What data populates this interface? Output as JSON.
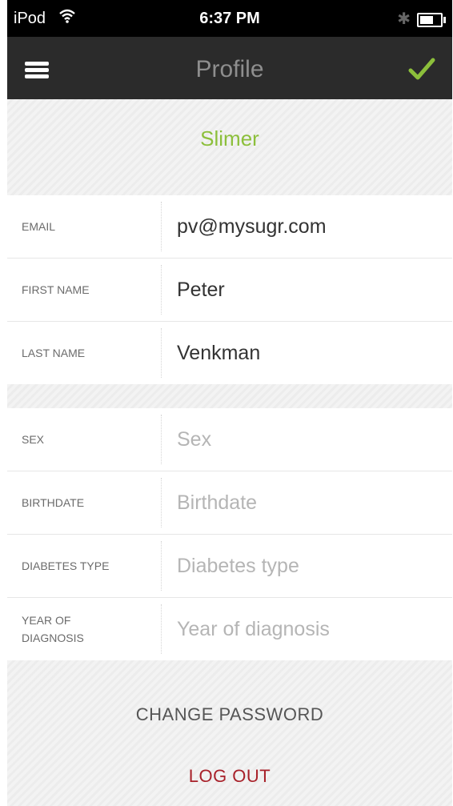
{
  "status_bar": {
    "carrier": "iPod",
    "time": "6:37 PM",
    "wifi_icon": "wifi-icon",
    "bluetooth_icon": "bluetooth-icon",
    "battery_icon": "battery-icon",
    "battery_level": 0.6
  },
  "navbar": {
    "title": "Profile",
    "menu_icon": "hamburger-menu-icon",
    "confirm_icon": "checkmark-icon",
    "confirm_color": "#8cbf3b"
  },
  "profile": {
    "display_name": "Slimer",
    "name_color": "#8cbf3b"
  },
  "account_fields": [
    {
      "label": "EMAIL",
      "value": "pv@mysugr.com"
    },
    {
      "label": "FIRST NAME",
      "value": "Peter"
    },
    {
      "label": "LAST NAME",
      "value": "Venkman"
    }
  ],
  "health_fields": [
    {
      "label": "SEX",
      "placeholder": "Sex"
    },
    {
      "label": "BIRTHDATE",
      "placeholder": "Birthdate"
    },
    {
      "label": "DIABETES TYPE",
      "placeholder": "Diabetes type"
    },
    {
      "label": "YEAR OF DIAGNOSIS",
      "placeholder": "Year of diagnosis"
    }
  ],
  "actions": {
    "change_password": "CHANGE PASSWORD",
    "log_out": "LOG OUT",
    "log_out_color": "#a8212a"
  }
}
